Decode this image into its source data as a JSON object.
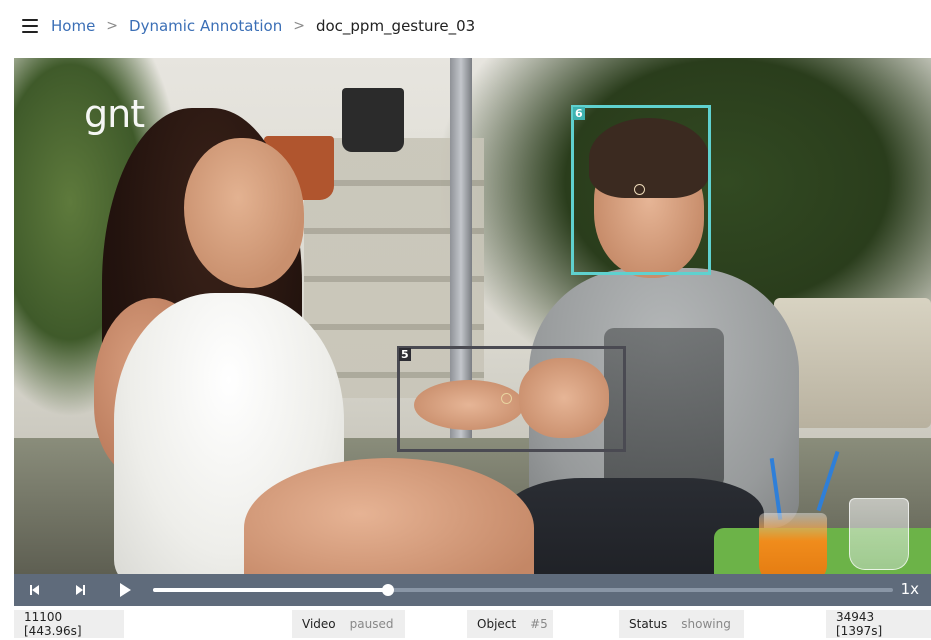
{
  "breadcrumb": {
    "home": "Home",
    "section": "Dynamic Annotation",
    "current": "doc_ppm_gesture_03",
    "separator": ">"
  },
  "video": {
    "watermark": "gnt",
    "annotations": [
      {
        "id": "6",
        "label": "6",
        "color": "#5fd1cf",
        "target": "face"
      },
      {
        "id": "5",
        "label": "5",
        "color": "#4a4a52",
        "target": "hands"
      }
    ]
  },
  "controls": {
    "prev_icon": "skip-previous-icon",
    "next_icon": "skip-next-icon",
    "play_icon": "play-icon",
    "progress_fraction": 0.3176,
    "speed": "1x"
  },
  "status": {
    "current_frame": "11100 [443.96s]",
    "video_label": "Video",
    "video_value": "paused",
    "object_label": "Object",
    "object_value": "#5",
    "status_label": "Status",
    "status_value": "showing",
    "total_frames": "34943 [1397s]"
  }
}
